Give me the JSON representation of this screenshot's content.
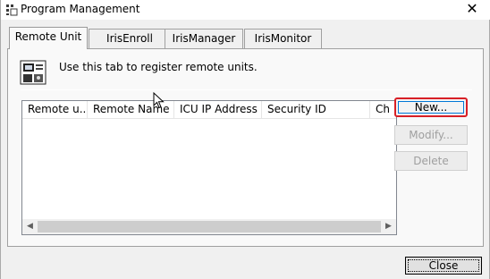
{
  "window": {
    "title": "Program Management",
    "close_glyph": "✕",
    "app_icon": "grid-app-icon"
  },
  "tabs": [
    {
      "label": "Remote Unit",
      "active": true
    },
    {
      "label": "IrisEnroll",
      "active": false
    },
    {
      "label": "IrisManager",
      "active": false
    },
    {
      "label": "IrisMonitor",
      "active": false
    }
  ],
  "panel": {
    "description": "Use this tab to register remote units.",
    "icon": "remote-unit-register-icon"
  },
  "list": {
    "columns": [
      "Remote u...",
      "Remote Name",
      "ICU IP Address",
      "Security ID",
      "Ch"
    ],
    "rows": []
  },
  "buttons": {
    "new": "New...",
    "modify": "Modify...",
    "delete": "Delete",
    "close": "Close"
  },
  "colors": {
    "highlight": "#d81f26",
    "focus_border": "#0078d7"
  }
}
